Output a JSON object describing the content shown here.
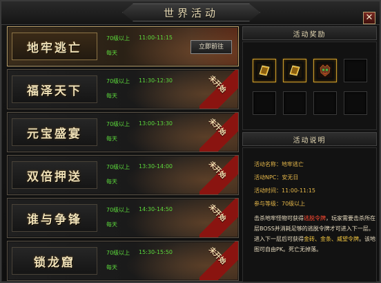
{
  "window": {
    "title": "世界活动",
    "close_label": "✕"
  },
  "events": [
    {
      "name": "地牢逃亡",
      "level": "70级以上",
      "time": "11:00-11:15",
      "frequency": "每天",
      "button": "立即前往",
      "status": "",
      "selected": true
    },
    {
      "name": "福泽天下",
      "level": "70级以上",
      "time": "11:30-12:30",
      "frequency": "每天",
      "button": "",
      "status": "未开始",
      "selected": false
    },
    {
      "name": "元宝盛宴",
      "level": "70级以上",
      "time": "13:00-13:30",
      "frequency": "每天",
      "button": "",
      "status": "未开始",
      "selected": false
    },
    {
      "name": "双倍押送",
      "level": "70级以上",
      "time": "13:30-14:00",
      "frequency": "每天",
      "button": "",
      "status": "未开始",
      "selected": false
    },
    {
      "name": "谁与争锋",
      "level": "70级以上",
      "time": "14:30-14:50",
      "frequency": "每天",
      "button": "",
      "status": "未开始",
      "selected": false
    },
    {
      "name": "锁龙窟",
      "level": "70级以上",
      "time": "15:30-15:50",
      "frequency": "每天",
      "button": "",
      "status": "未开始",
      "selected": false
    }
  ],
  "rewards": {
    "title": "活动奖励",
    "slots": [
      {
        "icon": "gold-token-icon",
        "filled": true
      },
      {
        "icon": "gold-token-icon",
        "filled": true
      },
      {
        "icon": "demon-mask-icon",
        "filled": true
      },
      {
        "icon": "",
        "filled": false
      },
      {
        "icon": "",
        "filled": false
      },
      {
        "icon": "",
        "filled": false
      },
      {
        "icon": "",
        "filled": false
      },
      {
        "icon": "",
        "filled": false
      }
    ]
  },
  "description": {
    "title": "活动说明",
    "name_label": "活动名称：",
    "name_value": "地牢逃亡",
    "npc_label": "活动NPC：",
    "npc_value": "安无日",
    "time_label": "活动时间：",
    "time_value": "11:00-11:15",
    "level_label": "参与等级：",
    "level_value": "70级以上",
    "text_parts": [
      {
        "t": "击杀地牢怪物可获得",
        "c": ""
      },
      {
        "t": "逃脱令牌",
        "c": "hl-red"
      },
      {
        "t": "，玩家需要击杀所在层BOSS并消耗足够的逃脱令牌才可进入下一层。进入下一层后可获得",
        "c": ""
      },
      {
        "t": "金砖、金条、威望令牌",
        "c": "hl-gold"
      },
      {
        "t": "。该地图可自由PK。死亡无掉落。",
        "c": ""
      }
    ]
  },
  "colors": {
    "accent": "#c2a46a",
    "green_text": "#5ddc3c",
    "ribbon": "#8a1410",
    "info_gold": "#e6b84a"
  }
}
